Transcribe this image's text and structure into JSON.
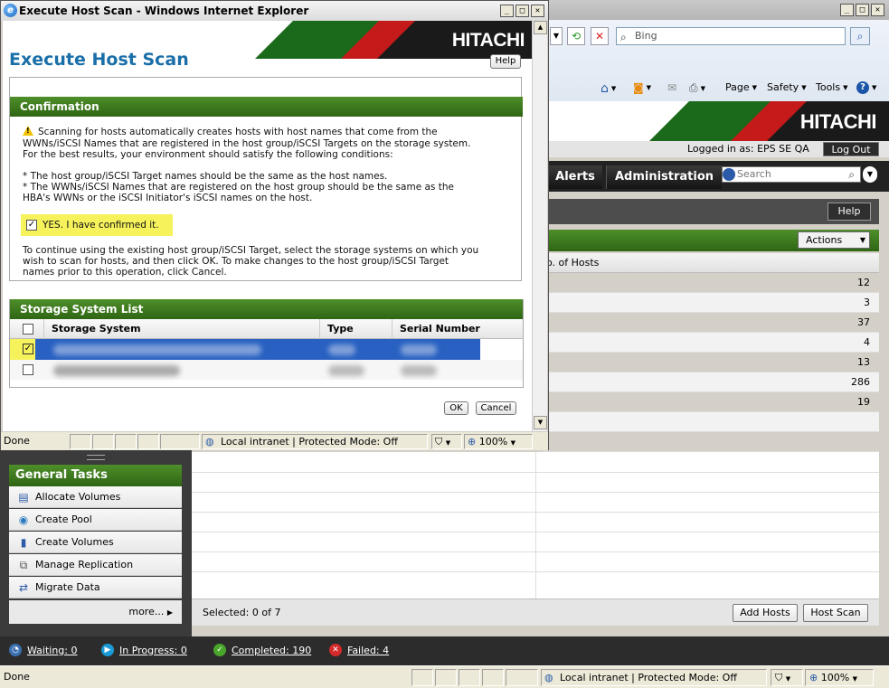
{
  "popup": {
    "window_title": "Execute Host Scan - Windows Internet Explorer",
    "logo": "HITACHI",
    "page_title": "Execute Host Scan",
    "help_label": "Help",
    "confirmation": {
      "header": "Confirmation",
      "lines": [
        "Scanning for hosts automatically creates hosts with host names that come from the",
        "WWNs/iSCSI Names that are registered in the host group/iSCSI Targets on the storage system.",
        "For the best results, your environment should satisfy the following conditions:",
        "* The host group/iSCSI Target names should be the same as the host names.",
        "* The WWNs/iSCSI Names that are registered on the host group should be the same as the",
        "HBA's WWNs or the iSCSI Initiator's iSCSI names on the host."
      ],
      "checkbox_label": "YES. I have confirmed it.",
      "checkbox_checked": true,
      "instructions": [
        "To continue using the existing host group/iSCSI Target, select the storage systems on which you",
        "wish to scan for hosts, and then click OK. To make changes to the host group/iSCSI Target",
        "names prior to this operation, click Cancel."
      ]
    },
    "storage_list": {
      "header": "Storage System List",
      "columns": [
        "Storage System",
        "Type",
        "Serial Number"
      ],
      "rows": [
        {
          "checked": true,
          "selected": true
        },
        {
          "checked": false,
          "selected": false
        }
      ]
    },
    "ok_label": "OK",
    "cancel_label": "Cancel",
    "status": {
      "done": "Done",
      "zone": "Local intranet | Protected Mode: Off",
      "zoom": "100%"
    }
  },
  "main": {
    "bing_placeholder": "Bing",
    "command_bar": [
      "Page",
      "Safety",
      "Tools"
    ],
    "logo": "HITACHI",
    "logged_in_as": "Logged in as: EPS SE QA",
    "logout_label": "Log Out",
    "tabs": [
      "Alerts",
      "Administration"
    ],
    "search_placeholder": "Search",
    "help_label": "Help",
    "actions_label": "Actions",
    "column_header": "o. of Hosts",
    "host_counts": [
      "12",
      "3",
      "37",
      "4",
      "13",
      "286",
      "19"
    ],
    "selected_text": "Selected: 0 of 7",
    "add_hosts_label": "Add Hosts",
    "host_scan_label": "Host Scan",
    "general_tasks": {
      "header": "General Tasks",
      "items": [
        "Allocate Volumes",
        "Create Pool",
        "Create Volumes",
        "Manage Replication",
        "Migrate Data"
      ],
      "more": "more..."
    },
    "jobs": [
      {
        "label": "Waiting: 0",
        "color": "#3a6fb0"
      },
      {
        "label": "In Progress: 0",
        "color": "#1a9ad6"
      },
      {
        "label": "Completed: 190",
        "color": "#4aa52b"
      },
      {
        "label": "Failed: 4",
        "color": "#d42a2a"
      }
    ],
    "status": {
      "done": "Done",
      "zone": "Local intranet | Protected Mode: Off",
      "zoom": "100%"
    }
  }
}
